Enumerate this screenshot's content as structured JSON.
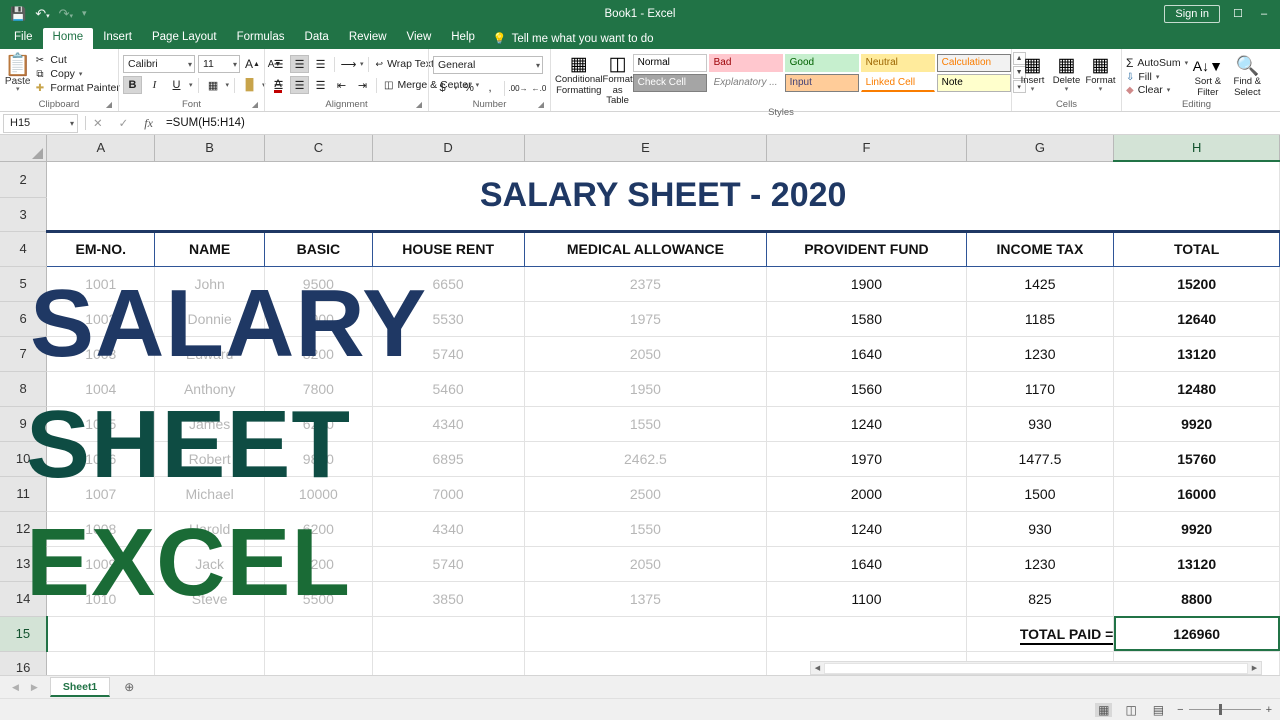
{
  "titlebar": {
    "document_title": "Book1  -  Excel",
    "signin_label": "Sign in",
    "save_icon": "save-icon",
    "undo_icon": "undo-icon",
    "redo_icon": "redo-icon",
    "customize_icon": "customize-quick-access-icon",
    "ribbon_options_icon": "ribbon-display-options-icon",
    "minimize_icon": "minimize-icon"
  },
  "tabs": [
    {
      "label": "File",
      "active": false
    },
    {
      "label": "Home",
      "active": true
    },
    {
      "label": "Insert",
      "active": false
    },
    {
      "label": "Page Layout",
      "active": false
    },
    {
      "label": "Formulas",
      "active": false
    },
    {
      "label": "Data",
      "active": false
    },
    {
      "label": "Review",
      "active": false
    },
    {
      "label": "View",
      "active": false
    },
    {
      "label": "Help",
      "active": false
    }
  ],
  "tellme": {
    "placeholder": "Tell me what you want to do",
    "icon": "lightbulb-icon"
  },
  "ribbon": {
    "clipboard": {
      "group_label": "Clipboard",
      "paste_label": "Paste",
      "items": [
        {
          "label": "Cut",
          "icon": "scissors-icon"
        },
        {
          "label": "Copy",
          "icon": "copy-icon"
        },
        {
          "label": "Format Painter",
          "icon": "format-painter-icon"
        }
      ]
    },
    "font": {
      "group_label": "Font",
      "font_name": "Calibri",
      "font_size": "11",
      "grow_label": "A",
      "shrink_label": "A",
      "bold": "B",
      "italic": "I",
      "underline": "U",
      "borders_icon": "borders-icon",
      "fill_icon": "fill-color-icon",
      "fontcolor_icon": "font-color-icon"
    },
    "alignment": {
      "group_label": "Alignment",
      "wrap_text": "Wrap Text",
      "merge_center": "Merge & Center",
      "orientation_icon": "orientation-icon",
      "indent_decrease_icon": "decrease-indent-icon",
      "indent_increase_icon": "increase-indent-icon"
    },
    "number": {
      "group_label": "Number",
      "format": "General",
      "currency": "$",
      "percent": "%",
      "comma": ",",
      "increase_decimal": "increase-decimal-icon",
      "decrease_decimal": "decrease-decimal-icon"
    },
    "styles": {
      "group_label": "Styles",
      "conditional_formatting": "Conditional Formatting",
      "format_as_table": "Format as Table",
      "cells": [
        {
          "label": "Normal",
          "bg": "#ffffff",
          "fg": "#000000",
          "border": "#c7c7c7"
        },
        {
          "label": "Bad",
          "bg": "#ffc7ce",
          "fg": "#9c0006",
          "border": "#ffc7ce"
        },
        {
          "label": "Good",
          "bg": "#c6efce",
          "fg": "#006100",
          "border": "#c6efce"
        },
        {
          "label": "Neutral",
          "bg": "#ffeb9c",
          "fg": "#9c6500",
          "border": "#ffeb9c"
        },
        {
          "label": "Calculation",
          "bg": "#f2f2f2",
          "fg": "#fa7d00",
          "border": "#7f7f7f"
        },
        {
          "label": "Check Cell",
          "bg": "#a5a5a5",
          "fg": "#ffffff",
          "border": "#7f7f7f"
        },
        {
          "label": "Explanatory ...",
          "bg": "#ffffff",
          "fg": "#7f7f7f",
          "border": "#ffffff"
        },
        {
          "label": "Input",
          "bg": "#ffcc99",
          "fg": "#3f3f76",
          "border": "#7f7f7f"
        },
        {
          "label": "Linked Cell",
          "bg": "#ffffff",
          "fg": "#fa7d00",
          "border": "#ffffff"
        },
        {
          "label": "Note",
          "bg": "#ffffcc",
          "fg": "#000000",
          "border": "#b2b2b2"
        }
      ]
    },
    "cells": {
      "group_label": "Cells",
      "insert": "Insert",
      "delete": "Delete",
      "format": "Format"
    },
    "editing": {
      "group_label": "Editing",
      "autosum": "AutoSum",
      "fill": "Fill",
      "clear": "Clear",
      "sort_filter": "Sort &\nFilter",
      "sort_filter_l1": "Sort &",
      "sort_filter_l2": "Filter",
      "find_select_l1": "Find &",
      "find_select_l2": "Select"
    }
  },
  "formula_bar": {
    "name_box": "H15",
    "formula": "=SUM(H5:H14)",
    "cancel_icon": "cancel-icon",
    "enter_icon": "enter-checkmark-icon",
    "function_icon": "insert-function-icon"
  },
  "grid": {
    "columns": [
      "A",
      "B",
      "C",
      "D",
      "E",
      "F",
      "G",
      "H"
    ],
    "selected_column": "H",
    "rows": [
      "2",
      "3",
      "4",
      "5",
      "6",
      "7",
      "8",
      "9",
      "10",
      "11",
      "12",
      "13",
      "14",
      "15",
      "16"
    ],
    "selected_row": "15",
    "sheet_title": "SALARY SHEET - 2020",
    "headers": [
      "EM-NO.",
      "NAME",
      "BASIC",
      "HOUSE RENT",
      "MEDICAL ALLOWANCE",
      "PROVIDENT FUND",
      "INCOME TAX",
      "TOTAL"
    ],
    "records": [
      {
        "row": "5",
        "em_no": "1001",
        "name": "John",
        "basic": "9500",
        "house_rent": "6650",
        "medical": "2375",
        "provident": "1900",
        "income_tax": "1425",
        "total": "15200"
      },
      {
        "row": "6",
        "em_no": "1002",
        "name": "Donnie",
        "basic": "7900",
        "house_rent": "5530",
        "medical": "1975",
        "provident": "1580",
        "income_tax": "1185",
        "total": "12640"
      },
      {
        "row": "7",
        "em_no": "1003",
        "name": "Edward",
        "basic": "8200",
        "house_rent": "5740",
        "medical": "2050",
        "provident": "1640",
        "income_tax": "1230",
        "total": "13120"
      },
      {
        "row": "8",
        "em_no": "1004",
        "name": "Anthony",
        "basic": "7800",
        "house_rent": "5460",
        "medical": "1950",
        "provident": "1560",
        "income_tax": "1170",
        "total": "12480"
      },
      {
        "row": "9",
        "em_no": "1005",
        "name": "James",
        "basic": "6200",
        "house_rent": "4340",
        "medical": "1550",
        "provident": "1240",
        "income_tax": "930",
        "total": "9920"
      },
      {
        "row": "10",
        "em_no": "1006",
        "name": "Robert",
        "basic": "9850",
        "house_rent": "6895",
        "medical": "2462.5",
        "provident": "1970",
        "income_tax": "1477.5",
        "total": "15760"
      },
      {
        "row": "11",
        "em_no": "1007",
        "name": "Michael",
        "basic": "10000",
        "house_rent": "7000",
        "medical": "2500",
        "provident": "2000",
        "income_tax": "1500",
        "total": "16000"
      },
      {
        "row": "12",
        "em_no": "1008",
        "name": "Harold",
        "basic": "6200",
        "house_rent": "4340",
        "medical": "1550",
        "provident": "1240",
        "income_tax": "930",
        "total": "9920"
      },
      {
        "row": "13",
        "em_no": "1009",
        "name": "Jack",
        "basic": "8200",
        "house_rent": "5740",
        "medical": "2050",
        "provident": "1640",
        "income_tax": "1230",
        "total": "13120"
      },
      {
        "row": "14",
        "em_no": "1010",
        "name": "Steve",
        "basic": "5500",
        "house_rent": "3850",
        "medical": "1375",
        "provident": "1100",
        "income_tax": "825",
        "total": "8800"
      }
    ],
    "total_label": "TOTAL PAID =",
    "grand_total": "126960"
  },
  "overlay": {
    "line1": "SALARY",
    "line2": "SHEET",
    "line3": "EXCEL",
    "color1": "#1f3864",
    "color2": "#0e4c43",
    "color3": "#1a6b36"
  },
  "sheet_tabs": {
    "prev_icon": "previous-sheet-icon",
    "next_icon": "next-sheet-icon",
    "tabs": [
      {
        "label": "Sheet1",
        "active": true
      }
    ],
    "add_label": "+"
  },
  "status_bar": {
    "normal_view_icon": "normal-view-icon",
    "page_layout_icon": "page-layout-view-icon",
    "page_break_icon": "page-break-preview-icon",
    "zoom_out": "−",
    "zoom_in": "+"
  }
}
